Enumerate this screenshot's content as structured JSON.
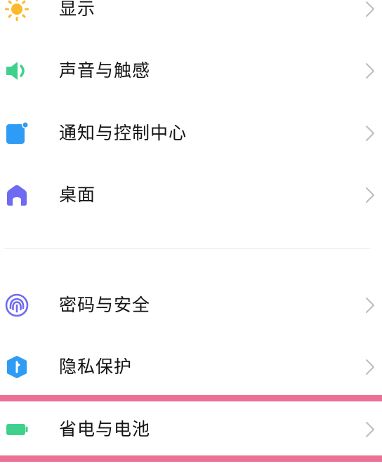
{
  "settings": {
    "items": [
      {
        "label": "显示",
        "icon": "sun-icon",
        "color": "#FBB92B"
      },
      {
        "label": "声音与触感",
        "icon": "speaker-icon",
        "color": "#3FD18C"
      },
      {
        "label": "通知与控制中心",
        "icon": "notification-icon",
        "color": "#2E9CF5"
      },
      {
        "label": "桌面",
        "icon": "home-icon",
        "color": "#6E6BF2"
      },
      {
        "label": "密码与安全",
        "icon": "fingerprint-icon",
        "color": "#6E6BF2"
      },
      {
        "label": "隐私保护",
        "icon": "privacy-shield-icon",
        "color": "#2E9CF5"
      },
      {
        "label": "省电与电池",
        "icon": "battery-icon",
        "color": "#3FD18C"
      }
    ],
    "chevron_icon": "chevron-right-icon",
    "chevron_color": "#BDBDBD"
  },
  "highlight": {
    "target": "省电与电池",
    "color": "#EC6F94"
  }
}
